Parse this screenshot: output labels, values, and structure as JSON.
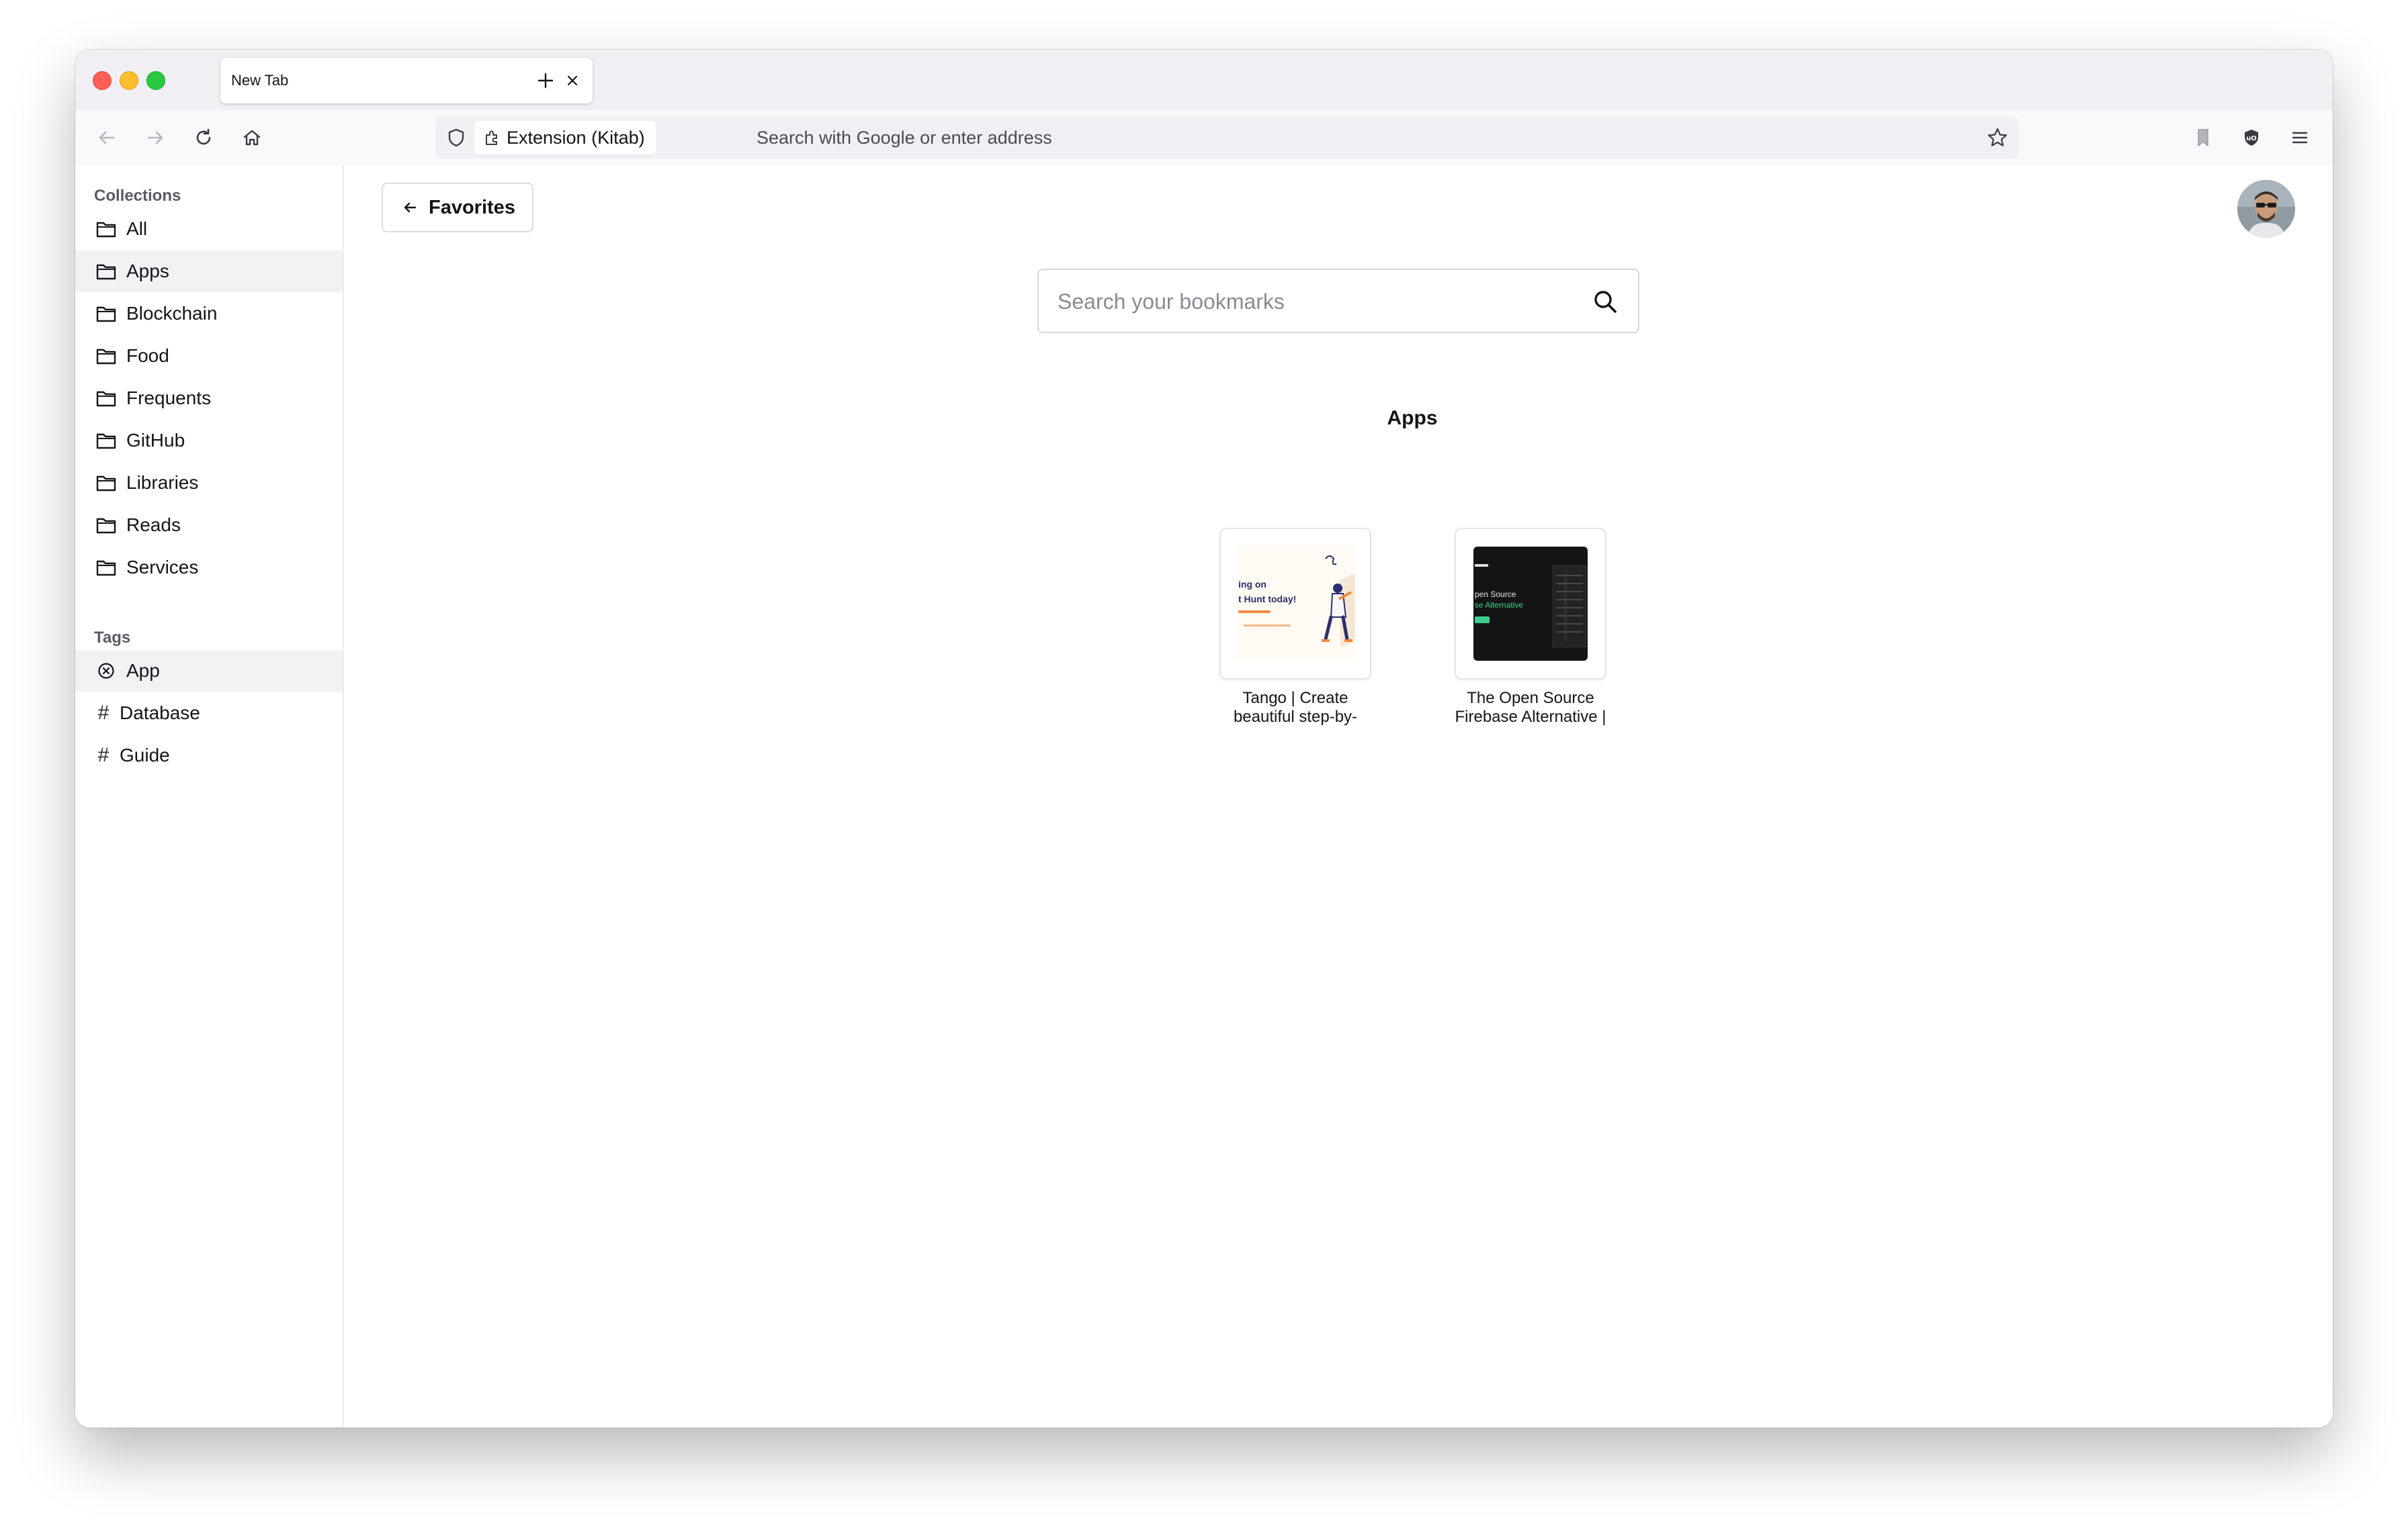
{
  "browser": {
    "tab": {
      "title": "New Tab",
      "close_icon": "close-icon"
    },
    "new_tab_icon": "plus-icon",
    "nav": {
      "back_icon": "arrow-left-icon",
      "forward_icon": "arrow-right-icon",
      "reload_icon": "reload-icon",
      "home_icon": "home-icon"
    },
    "urlbar": {
      "extension_label": "Extension (Kitab)",
      "placeholder": "Search with Google or enter address"
    },
    "toolbar_right": [
      "bookmarks-icon",
      "shield-extension-icon",
      "menu-icon"
    ]
  },
  "sidebar": {
    "collections_heading": "Collections",
    "collections": [
      {
        "label": "All",
        "active": false
      },
      {
        "label": "Apps",
        "active": true
      },
      {
        "label": "Blockchain",
        "active": false
      },
      {
        "label": "Food",
        "active": false
      },
      {
        "label": "Frequents",
        "active": false
      },
      {
        "label": "GitHub",
        "active": false
      },
      {
        "label": "Libraries",
        "active": false
      },
      {
        "label": "Reads",
        "active": false
      },
      {
        "label": "Services",
        "active": false
      }
    ],
    "tags_heading": "Tags",
    "tags": [
      {
        "label": "App",
        "active": true,
        "marker": "⊗"
      },
      {
        "label": "Database",
        "active": false,
        "marker": "#"
      },
      {
        "label": "Guide",
        "active": false,
        "marker": "#"
      }
    ]
  },
  "main": {
    "back_button_label": "Favorites",
    "search_placeholder": "Search your bookmarks",
    "group_title": "Apps",
    "bookmarks": [
      {
        "title_line1": "Tango | Create",
        "title_line2": "beautiful step-by-",
        "thumb_text1": "ing on",
        "thumb_text2": "t Hunt today!"
      },
      {
        "title_line1": "The Open Source",
        "title_line2": "Firebase Alternative |",
        "thumb_text1": "pen Source",
        "thumb_text2": "se Alternative"
      }
    ]
  },
  "colors": {
    "window_bg": "#ffffff",
    "tabstrip_bg": "#f0f0f4",
    "active_row_bg": "#f2f2f4",
    "accent_dark": "#15141a"
  }
}
